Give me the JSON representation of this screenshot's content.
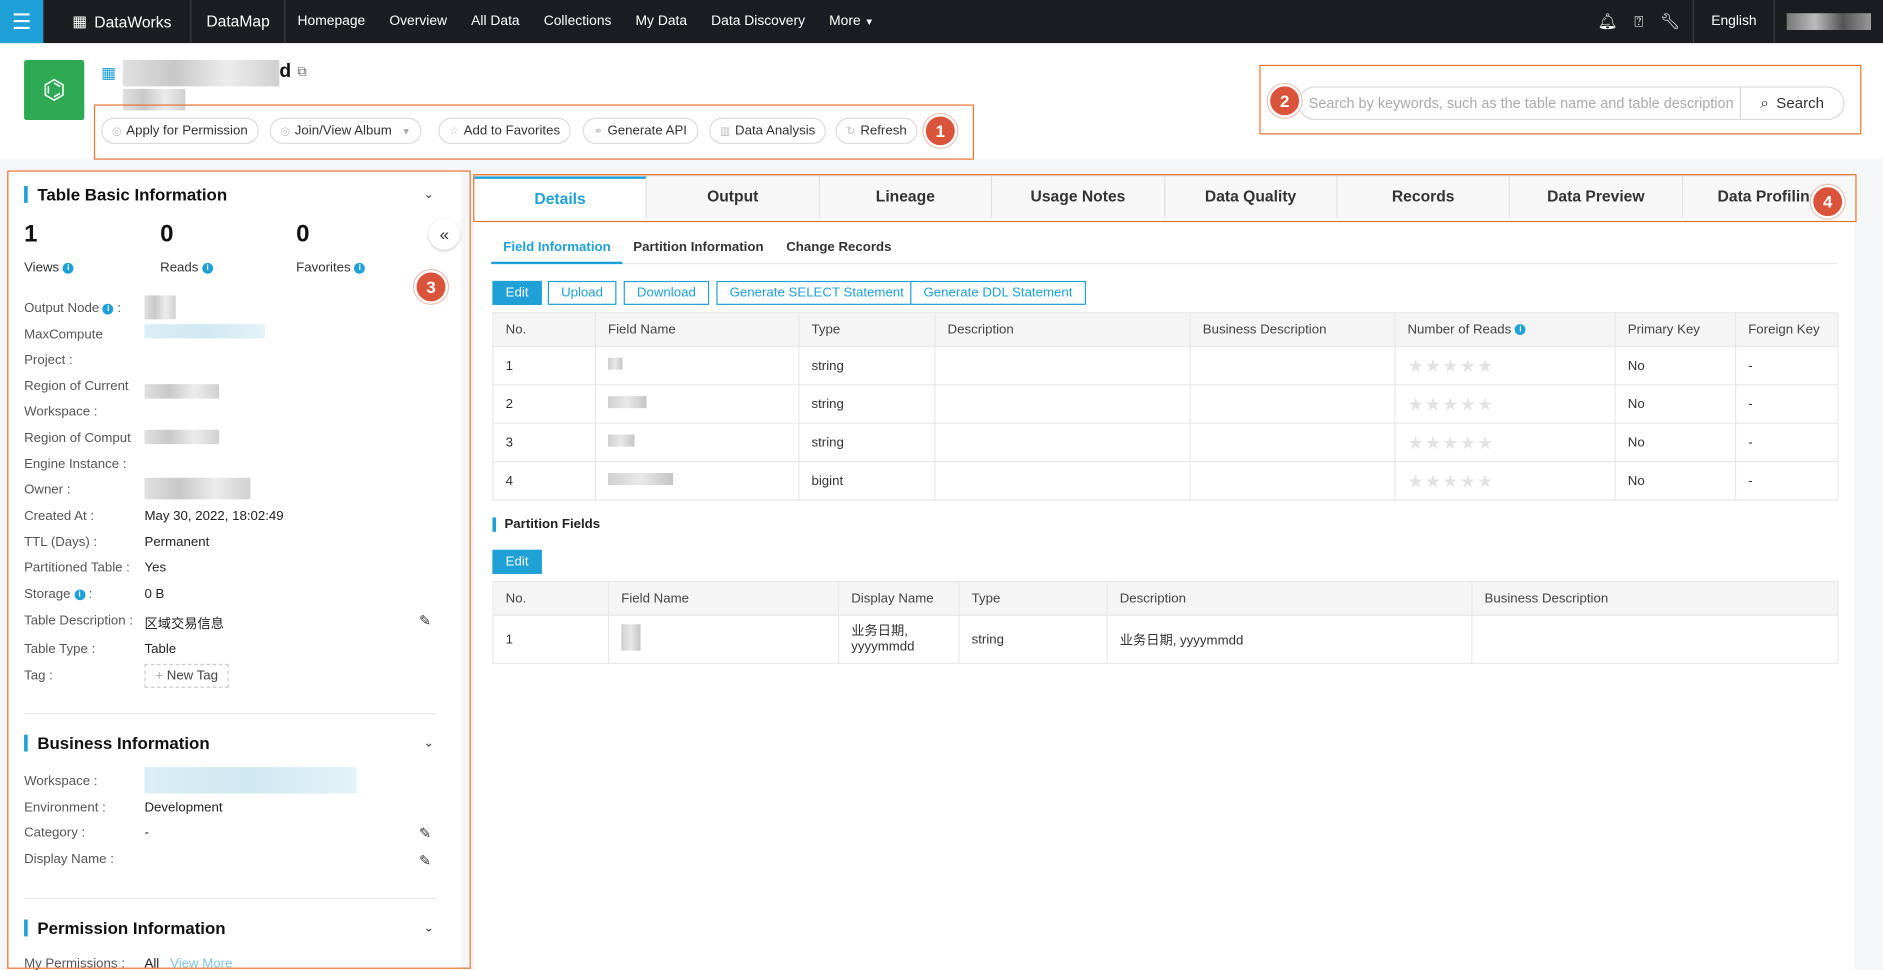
{
  "nav": {
    "brand": "DataWorks",
    "module": "DataMap",
    "items": [
      "Homepage",
      "Overview",
      "All Data",
      "Collections",
      "My Data",
      "Data Discovery",
      "More"
    ],
    "language": "English"
  },
  "header": {
    "title_suffix": "d",
    "actions": [
      "Apply for Permission",
      "Join/View Album",
      "Add to Favorites",
      "Generate API",
      "Data Analysis",
      "Refresh"
    ],
    "search_placeholder": "Search by keywords, such as the table name and table description",
    "search_button": "Search"
  },
  "annotations": [
    "1",
    "2",
    "3",
    "4"
  ],
  "basic": {
    "title": "Table Basic Information",
    "stats": [
      {
        "value": "1",
        "label": "Views"
      },
      {
        "value": "0",
        "label": "Reads"
      },
      {
        "value": "0",
        "label": "Favorites"
      }
    ],
    "fields": [
      {
        "label": "Output Node",
        "value": ""
      },
      {
        "label": "MaxCompute",
        "value": ""
      },
      {
        "label": "Project :",
        "value": ""
      },
      {
        "label": "Region of Current",
        "value": ""
      },
      {
        "label": "Workspace :",
        "value": ""
      },
      {
        "label": "Region of Comput",
        "value": ""
      },
      {
        "label": "Engine Instance :",
        "value": ""
      },
      {
        "label": "Owner :",
        "value": ""
      },
      {
        "label": "Created At :",
        "value": "May 30, 2022, 18:02:49"
      },
      {
        "label": "TTL (Days) :",
        "value": "Permanent"
      },
      {
        "label": "Partitioned Table :",
        "value": "Yes"
      },
      {
        "label": "Storage",
        "value": "0 B"
      },
      {
        "label": "Table Description :",
        "value": "区域交易信息"
      },
      {
        "label": "Table Type :",
        "value": "Table"
      },
      {
        "label": "Tag :",
        "value": "New Tag"
      }
    ]
  },
  "business": {
    "title": "Business Information",
    "fields": [
      {
        "label": "Workspace :",
        "value": ""
      },
      {
        "label": "Environment :",
        "value": "Development"
      },
      {
        "label": "Category :",
        "value": "-"
      },
      {
        "label": "Display Name :",
        "value": ""
      }
    ]
  },
  "permission": {
    "title": "Permission Information",
    "label": "My Permissions :",
    "value": "All",
    "link": "View More"
  },
  "tabs": [
    "Details",
    "Output",
    "Lineage",
    "Usage Notes",
    "Data Quality",
    "Records",
    "Data Preview",
    "Data Profiling"
  ],
  "subtabs": [
    "Field Information",
    "Partition Information",
    "Change Records"
  ],
  "field_buttons": [
    "Edit",
    "Upload",
    "Download",
    "Generate SELECT Statement",
    "Generate DDL Statement"
  ],
  "field_table": {
    "columns": [
      "No.",
      "Field Name",
      "Type",
      "Description",
      "Business Description",
      "Number of Reads",
      "Primary Key",
      "Foreign Key"
    ],
    "rows": [
      {
        "no": "1",
        "type": "string",
        "pk": "No",
        "fk": "-"
      },
      {
        "no": "2",
        "type": "string",
        "pk": "No",
        "fk": "-"
      },
      {
        "no": "3",
        "type": "string",
        "pk": "No",
        "fk": "-"
      },
      {
        "no": "4",
        "type": "bigint",
        "pk": "No",
        "fk": "-"
      }
    ]
  },
  "partition": {
    "title": "Partition Fields",
    "edit": "Edit",
    "columns": [
      "No.",
      "Field Name",
      "Display Name",
      "Type",
      "Description",
      "Business Description"
    ],
    "rows": [
      {
        "no": "1",
        "display": "业务日期, yyyymmdd",
        "type": "string",
        "description": "业务日期, yyyymmdd"
      }
    ]
  }
}
